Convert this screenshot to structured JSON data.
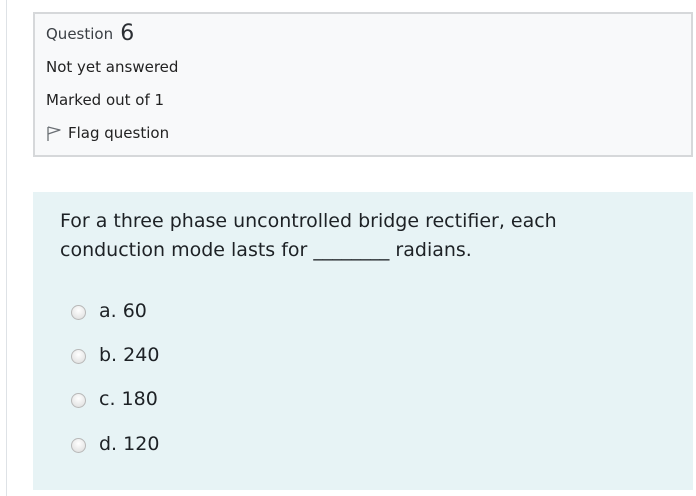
{
  "info": {
    "question_label": "Question",
    "question_number": "6",
    "state": "Not yet answered",
    "grade": "Marked out of 1",
    "flag_label": "Flag question"
  },
  "question": {
    "text": "For a three phase uncontrolled bridge rectifier, each conduction mode lasts for ________ radians.",
    "options": [
      {
        "label": "a. 60"
      },
      {
        "label": "b. 240"
      },
      {
        "label": "c. 180"
      },
      {
        "label": "d. 120"
      }
    ]
  },
  "colors": {
    "info_bg": "#f8f9fa",
    "content_bg": "#e7f3f5",
    "border": "#d6d8da"
  }
}
